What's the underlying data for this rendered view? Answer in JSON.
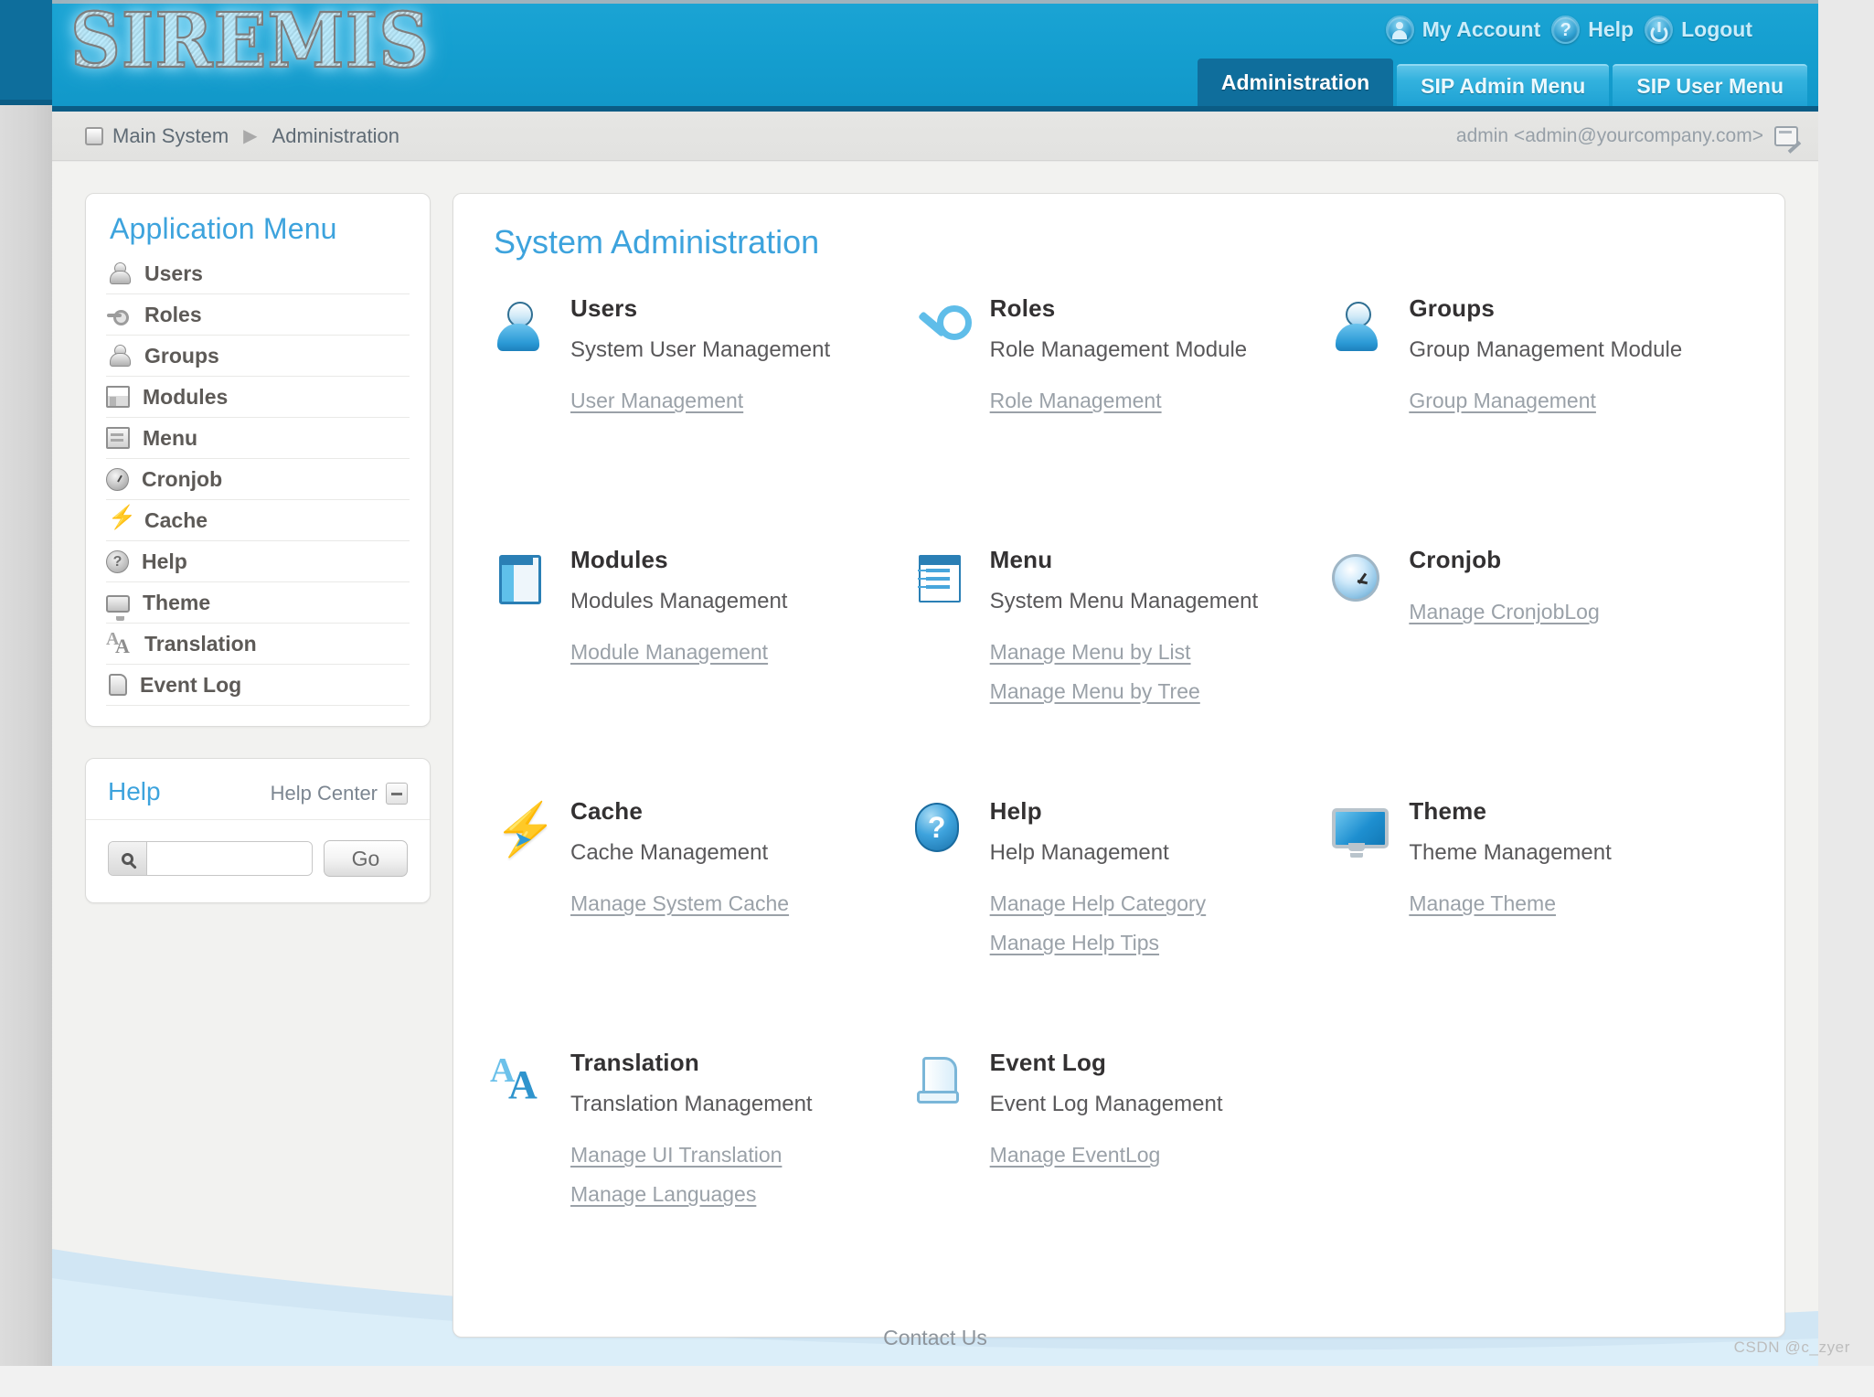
{
  "header": {
    "logo_text": "SIREMIS",
    "account_links": [
      {
        "label": "My Account",
        "icon": "user-circle-icon"
      },
      {
        "label": "Help",
        "icon": "question-circle-icon"
      },
      {
        "label": "Logout",
        "icon": "power-circle-icon"
      }
    ],
    "tabs": [
      {
        "label": "Administration",
        "active": true
      },
      {
        "label": "SIP Admin Menu",
        "active": false
      },
      {
        "label": "SIP User Menu",
        "active": false
      }
    ]
  },
  "breadcrumb": {
    "home_icon": "window-square-icon",
    "items": [
      "Main System",
      "Administration"
    ],
    "separator": "▶",
    "user": "admin <admin@yourcompany.com>",
    "edit_icon": "edit-note-icon"
  },
  "sidebar": {
    "app_menu_title": "Application Menu",
    "items": [
      {
        "label": "Users",
        "icon": "user-icon"
      },
      {
        "label": "Roles",
        "icon": "key-icon"
      },
      {
        "label": "Groups",
        "icon": "group-icon"
      },
      {
        "label": "Modules",
        "icon": "window-icon"
      },
      {
        "label": "Menu",
        "icon": "menu-icon"
      },
      {
        "label": "Cronjob",
        "icon": "clock-icon"
      },
      {
        "label": "Cache",
        "icon": "bolt-icon"
      },
      {
        "label": "Help",
        "icon": "question-icon"
      },
      {
        "label": "Theme",
        "icon": "monitor-icon"
      },
      {
        "label": "Translation",
        "icon": "translate-icon"
      },
      {
        "label": "Event Log",
        "icon": "scroll-icon"
      }
    ],
    "help_panel": {
      "title": "Help",
      "center_label": "Help Center",
      "minimize_icon": "minimize-icon",
      "search_icon": "search-icon",
      "search_value": "",
      "search_placeholder": "",
      "go_label": "Go"
    }
  },
  "main": {
    "title": "System Administration",
    "tiles": [
      {
        "name": "Users",
        "icon": "person-blue-icon",
        "desc": "System User Management",
        "links": [
          "User Management"
        ]
      },
      {
        "name": "Roles",
        "icon": "key-blue-icon",
        "desc": "Role Management Module",
        "links": [
          "Role Management"
        ]
      },
      {
        "name": "Groups",
        "icon": "person-blue-icon",
        "desc": "Group Management Module",
        "links": [
          "Group Management"
        ]
      },
      {
        "name": "Modules",
        "icon": "modules-blue-icon",
        "desc": "Modules Management",
        "links": [
          "Module Management"
        ]
      },
      {
        "name": "Menu",
        "icon": "menu-blue-icon",
        "desc": "System Menu Management",
        "links": [
          "Manage Menu by List",
          "Manage Menu by Tree"
        ]
      },
      {
        "name": "Cronjob",
        "icon": "clock-blue-icon",
        "desc": "",
        "links": [
          "Manage CronjobLog"
        ]
      },
      {
        "name": "Cache",
        "icon": "bolt-blue-icon",
        "desc": "Cache Management",
        "links": [
          "Manage System Cache"
        ]
      },
      {
        "name": "Help",
        "icon": "question-blue-icon",
        "desc": "Help Management",
        "links": [
          "Manage Help Category",
          "Manage Help Tips"
        ]
      },
      {
        "name": "Theme",
        "icon": "monitor-blue-icon",
        "desc": "Theme Management",
        "links": [
          "Manage Theme"
        ]
      },
      {
        "name": "Translation",
        "icon": "translate-blue-icon",
        "desc": "Translation Management",
        "links": [
          "Manage UI Translation",
          "Manage Languages"
        ]
      },
      {
        "name": "Event Log",
        "icon": "scroll-blue-icon",
        "desc": "Event Log Management",
        "links": [
          "Manage EventLog"
        ]
      }
    ]
  },
  "footer": {
    "contact_label": "Contact Us",
    "watermark": "CSDN @c_zyer"
  },
  "colors": {
    "header_cyan": "#159fd0",
    "tab_active": "#0f6e9c",
    "heading_blue": "#3da3dd",
    "link_gray": "#9aa1a8",
    "body_bg": "#f2f2f0",
    "wave_blue": "#c9e3f3"
  }
}
